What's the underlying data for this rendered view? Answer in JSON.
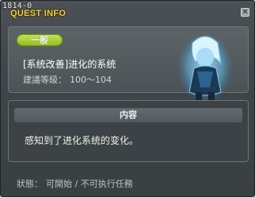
{
  "quest_id": "1814-0",
  "window": {
    "title": "QUEST INFO",
    "close_label": "×"
  },
  "quest": {
    "category": "一般",
    "name": "[系统改善]进化的系统",
    "level_label": "建議等級：",
    "level_range": "100～104"
  },
  "content": {
    "header": "内容",
    "text": "感知到了进化系统的变化。"
  },
  "status": {
    "label": "狀態：",
    "value": "可開始 / 不可执行任務"
  },
  "colors": {
    "title": "#ffd21a",
    "category_pill": "#a9cf2c",
    "window_bg": "#434a4d"
  }
}
